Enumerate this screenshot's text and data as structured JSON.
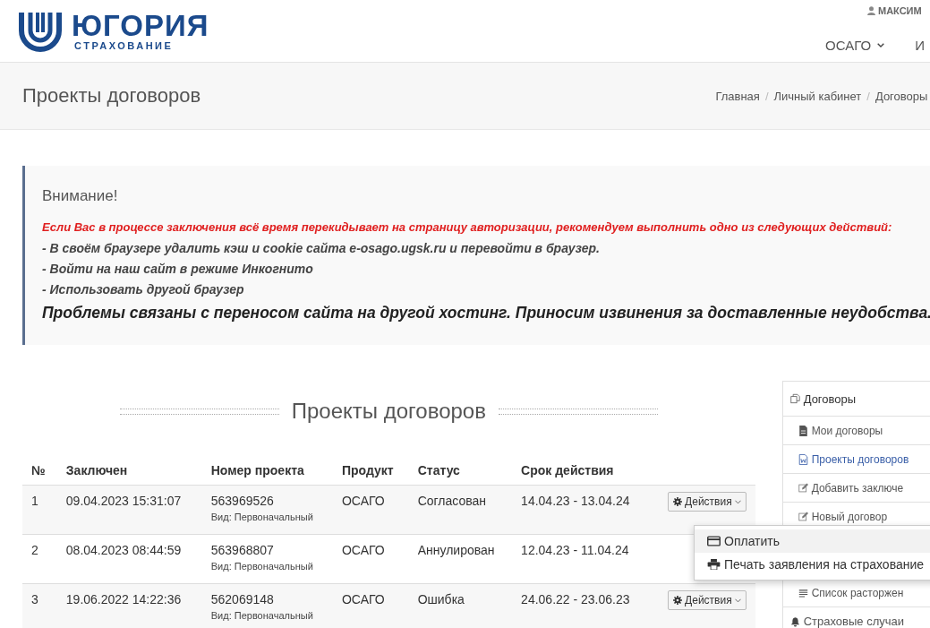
{
  "header": {
    "logo_name": "ЮГОРИЯ",
    "logo_sub": "СТРАХОВАНИЕ",
    "user": "МАКСИМ",
    "nav": [
      {
        "label": "ОСАГО",
        "dropdown": true
      },
      {
        "label": "И",
        "dropdown": false
      }
    ]
  },
  "title_bar": {
    "title": "Проекты договоров",
    "breadcrumbs": [
      "Главная",
      "Личный кабинет",
      "Договоры"
    ],
    "separator": "/"
  },
  "alert": {
    "title": "Внимание!",
    "lines": [
      {
        "kind": "warning",
        "text": "Если Вас в процессе заключения всё время перекидывает на страницу авторизации, рекомендуем выполнить одно из следующих действий:"
      },
      {
        "kind": "step",
        "text": "- В своём браузере удалить кэш и cookie сайта e-osago.ugsk.ru и перевойти в браузер."
      },
      {
        "kind": "step",
        "text": "- Войти на наш сайт в режиме Инкогнито"
      },
      {
        "kind": "step",
        "text": "- Использовать другой браузер"
      },
      {
        "kind": "notice",
        "text": "Проблемы связаны с переносом сайта на другой хостинг. Приносим извинения за доставленные неудобства."
      }
    ]
  },
  "section_title": "Проекты договоров",
  "table": {
    "columns": [
      "№",
      "Заключен",
      "Номер проекта",
      "Продукт",
      "Статус",
      "Срок действия"
    ],
    "rows": [
      {
        "num": "1",
        "date": "09.04.2023 15:31:07",
        "project": "563969526",
        "type": "Вид: Первоначальный",
        "product": "ОСАГО",
        "status": "Согласован",
        "period": "14.04.23 - 13.04.24",
        "actions": "Действия"
      },
      {
        "num": "2",
        "date": "08.04.2023 08:44:59",
        "project": "563968807",
        "type": "Вид: Первоначальный",
        "product": "ОСАГО",
        "status": "Аннулирован",
        "period": "12.04.23 - 11.04.24"
      },
      {
        "num": "3",
        "date": "19.06.2022 14:22:36",
        "project": "562069148",
        "type": "Вид: Первоначальный",
        "product": "ОСАГО",
        "status": "Ошибка",
        "period": "24.06.22 - 23.06.23",
        "actions": "Действия"
      }
    ]
  },
  "actions_menu": {
    "items": [
      {
        "label": "Оплатить",
        "kind": "card",
        "selected": true
      },
      {
        "label": "Печать заявления на страхование",
        "kind": "print",
        "selected": false
      }
    ]
  },
  "sidebar": {
    "title": "Договоры",
    "items": [
      {
        "label": "Мои договоры",
        "kind": "file",
        "selected": false
      },
      {
        "label": "Проекты договоров",
        "kind": "doc",
        "selected": true
      },
      {
        "label": "Добавить заключе",
        "kind": "edit",
        "selected": false
      },
      {
        "label": "Новый договор",
        "kind": "edit",
        "selected": false
      },
      {
        "label": "Список расторжен",
        "kind": "list",
        "selected": false,
        "gap_before": true
      },
      {
        "label": "Страховые случаи",
        "kind": "bell",
        "selected": false,
        "top_level": true
      }
    ]
  }
}
